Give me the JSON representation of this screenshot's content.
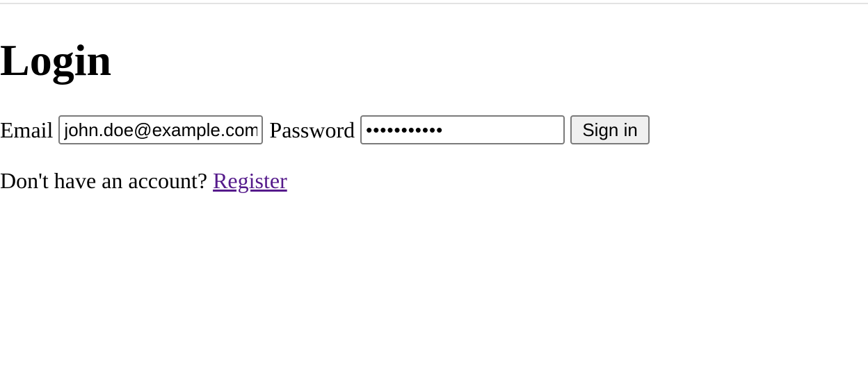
{
  "page": {
    "title": "Login"
  },
  "form": {
    "email_label": "Email",
    "email_value": "john.doe@example.com",
    "password_label": "Password",
    "password_value": "hunter2pass",
    "submit_label": "Sign in"
  },
  "footer": {
    "prompt_text": "Don't have an account?",
    "register_link_label": "Register"
  },
  "colors": {
    "link_visited": "#551a8b",
    "button_background": "#efefef",
    "input_border": "#7a7a7a"
  }
}
